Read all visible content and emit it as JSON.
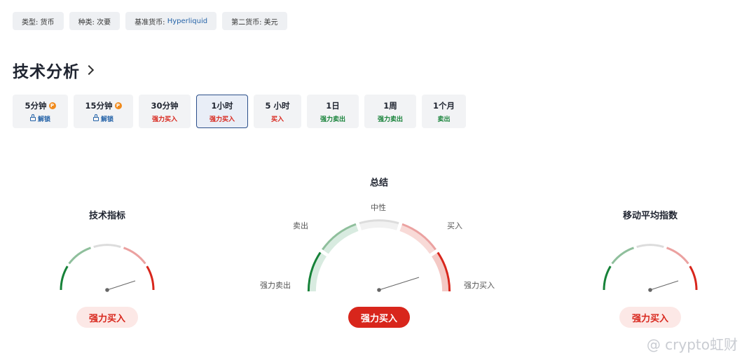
{
  "tags": [
    {
      "label": "类型: 货币"
    },
    {
      "label": "种类: 次要"
    },
    {
      "prefix": "基准货币: ",
      "value": "Hyperliquid"
    },
    {
      "label": "第二货币: 美元"
    }
  ],
  "section_title": "技术分析",
  "timeframes": [
    {
      "label": "5分钟",
      "sub": "解锁",
      "pro": true
    },
    {
      "label": "15分钟",
      "sub": "解锁",
      "pro": true
    },
    {
      "label": "30分钟",
      "sub": "强力买入"
    },
    {
      "label": "1小时",
      "sub": "强力买入",
      "active": true
    },
    {
      "label": "5 小时",
      "sub": "买入"
    },
    {
      "label": "1日",
      "sub": "强力卖出"
    },
    {
      "label": "1周",
      "sub": "强力卖出"
    },
    {
      "label": "1个月",
      "sub": "卖出"
    }
  ],
  "pro_badge": "P",
  "gauges": {
    "left": {
      "title": "技术指标",
      "result": "强力买入"
    },
    "center": {
      "title": "总结",
      "result": "强力买入",
      "labels": {
        "neutral": "中性",
        "sell": "卖出",
        "buy": "买入",
        "strong_sell": "强力卖出",
        "strong_buy": "强力买入"
      }
    },
    "right": {
      "title": "移动平均指数",
      "result": "强力买入"
    }
  },
  "watermark": "@ crypto虹财",
  "colors": {
    "strong_sell": "#178239",
    "sell": "#8fbf9c",
    "neutral": "#dcdcdc",
    "buy": "#eba1a0",
    "strong_buy": "#d8261c",
    "link": "#2563a8"
  }
}
